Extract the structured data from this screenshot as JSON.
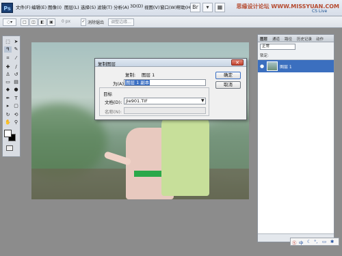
{
  "menu": {
    "logo": "Ps",
    "items": [
      "文件(F)",
      "编辑(E)",
      "图像(I)",
      "图层(L)",
      "选择(S)",
      "滤镜(T)",
      "分析(A)",
      "3D(D)",
      "视图(V)",
      "窗口(W)",
      "帮助(H)"
    ]
  },
  "watermark": "思缘设计论坛 WWW.MISSYUAN.COM",
  "cslive": "CS Live",
  "options": {
    "feather_value": "0 px",
    "antialias_label": "消除锯齿",
    "refine_edge": "调整边缘..."
  },
  "dialog": {
    "title": "复制图层",
    "copy_label": "复制:",
    "copy_value": "图层 1",
    "as_label": "为(A):",
    "as_value": "图层 1 副本",
    "ok": "确定",
    "cancel": "取消",
    "group_title": "目标",
    "doc_label": "文档(D):",
    "doc_value": "Jie901.TIF",
    "name_label": "名称(N):"
  },
  "layers": {
    "tabs": [
      "图层",
      "通道",
      "路径",
      "历史记录",
      "动作"
    ],
    "blend_mode": "正常",
    "lock_label": "锁定:",
    "layer_name": "图层 1"
  },
  "tray": {
    "ime": "中"
  }
}
